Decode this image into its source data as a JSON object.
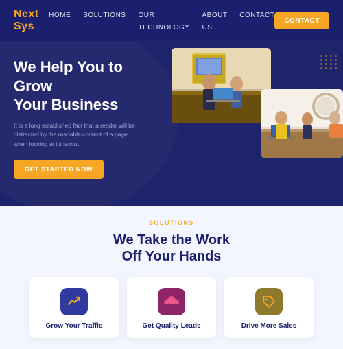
{
  "brand": {
    "logo": "Next Sys"
  },
  "nav": {
    "links": [
      {
        "label": "HOME",
        "href": "#"
      },
      {
        "label": "SOLUTIONS",
        "href": "#"
      },
      {
        "label": "OUR TECHNOLOGY",
        "href": "#"
      },
      {
        "label": "ABOUT US",
        "href": "#"
      },
      {
        "label": "CONTACT",
        "href": "#"
      }
    ],
    "contact_button": "CONTACT"
  },
  "hero": {
    "heading_line1": "We Help You to Grow",
    "heading_line2": "Your Business",
    "body": "It is a long established fact that a reader will be distracted by the readable content of a page when looking at its layout.",
    "cta_button": "GET STARTED NOW"
  },
  "solutions": {
    "section_label": "SOLUTIONS",
    "heading_line1": "We Take the Work",
    "heading_line2": "Off Your Hands",
    "cards": [
      {
        "title": "Grow Your Traffic",
        "icon": "📈",
        "icon_class": "icon-blue"
      },
      {
        "title": "Get Quality Leads",
        "icon": "☁️",
        "icon_class": "icon-pink"
      },
      {
        "title": "Drive More Sales",
        "icon": "🏷️",
        "icon_class": "icon-yellow"
      }
    ]
  }
}
